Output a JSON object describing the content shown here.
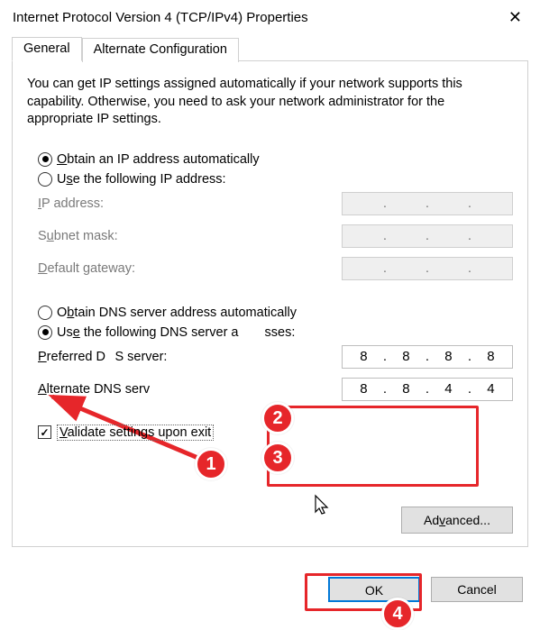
{
  "title": "Internet Protocol Version 4 (TCP/IPv4) Properties",
  "tabs": {
    "general": "General",
    "alternate": "Alternate Configuration"
  },
  "intro": "You can get IP settings assigned automatically if your network supports this capability. Otherwise, you need to ask your network administrator for the appropriate IP settings.",
  "ip_section": {
    "obtain_auto": "Obtain an IP address automatically",
    "use_following": "Use the following IP address:",
    "ip_address_label": "IP address:",
    "subnet_label": "Subnet mask:",
    "gateway_label": "Default gateway:",
    "ip_value": [
      "",
      "",
      "",
      ""
    ],
    "subnet_value": [
      "",
      "",
      "",
      ""
    ],
    "gateway_value": [
      "",
      "",
      "",
      ""
    ]
  },
  "dns_section": {
    "obtain_auto": "Obtain DNS server address automatically",
    "use_following_pre": "Use the following DNS server a",
    "use_following_post": "sses:",
    "preferred_label_pre": "Preferred D",
    "preferred_label_post": "S server:",
    "alternate_label_pre": "Alternate DNS serv",
    "preferred": [
      "8",
      "8",
      "8",
      "8"
    ],
    "alternate": [
      "8",
      "8",
      "4",
      "4"
    ]
  },
  "validate_label": "Validate settings upon exit",
  "advanced_label": "Advanced...",
  "buttons": {
    "ok": "OK",
    "cancel": "Cancel"
  },
  "annotations": {
    "b1": "1",
    "b2": "2",
    "b3": "3",
    "b4": "4"
  }
}
